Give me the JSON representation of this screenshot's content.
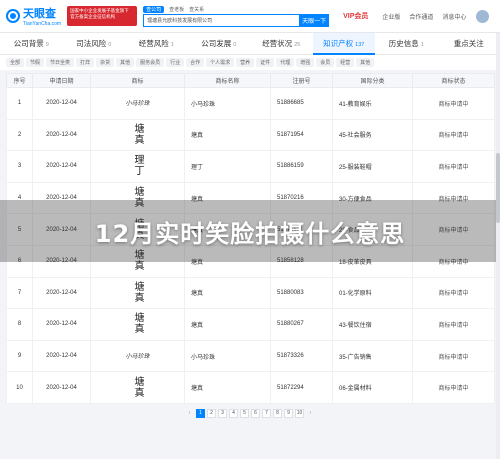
{
  "header": {
    "logo_text": "天眼查",
    "logo_sub": "TianYanCha.com",
    "banner_line1": "国家中小企业发展子基金旗下",
    "banner_line2": "官方备案企业征信机构",
    "search_tabs": [
      "查公司",
      "查老板",
      "查关系"
    ],
    "search_value": "理塘县允欧科技发展有限公司",
    "search_button": "天眼一下",
    "vip_label": "VIP会员",
    "nav": [
      "企业版",
      "合作通道",
      "消息中心"
    ]
  },
  "section_tabs": [
    {
      "label": "公司背景",
      "count": "9"
    },
    {
      "label": "司法风险",
      "count": "0"
    },
    {
      "label": "经营风险",
      "count": "1"
    },
    {
      "label": "公司发展",
      "count": "0"
    },
    {
      "label": "经营状况",
      "count": "25"
    },
    {
      "label": "知识产权",
      "count": "137"
    },
    {
      "label": "历史信息",
      "count": "1"
    },
    {
      "label": "重点关注",
      "count": ""
    }
  ],
  "active_tab_index": 5,
  "filters": [
    "全部",
    "节假",
    "节日全类",
    "打烊",
    "杂货",
    "其他",
    "服务会员",
    "行业",
    "合作",
    "个人需求",
    "营养",
    "证件",
    "代理",
    "增强",
    "会员",
    "经营",
    "其他"
  ],
  "table": {
    "columns": [
      "序号",
      "申请日期",
      "商标",
      "商标名称",
      "注册号",
      "国际分类",
      "商标状态"
    ],
    "rows": [
      {
        "no": "1",
        "date": "2020-12-04",
        "mark": "小马珍珠",
        "mark_style": "script",
        "name": "小马珍珠",
        "reg": "51886685",
        "class": "41-教育娱乐",
        "status": "商标申请中"
      },
      {
        "no": "2",
        "date": "2020-12-04",
        "mark": "塘真",
        "mark_style": "vertical",
        "name": "塘真",
        "reg": "51871954",
        "class": "45-社会服务",
        "status": "商标申请中"
      },
      {
        "no": "3",
        "date": "2020-12-04",
        "mark": "理丁",
        "mark_style": "vertical",
        "name": "理丁",
        "reg": "51886159",
        "class": "25-服装鞋帽",
        "status": "商标申请中"
      },
      {
        "no": "4",
        "date": "2020-12-04",
        "mark": "塘真",
        "mark_style": "vertical",
        "name": "塘真",
        "reg": "51870216",
        "class": "30-方便食品",
        "status": "商标申请中"
      },
      {
        "no": "5",
        "date": "2020-12-04",
        "mark": "塘真",
        "mark_style": "vertical",
        "name": "塘真",
        "reg": "51875511",
        "class": "29-食品",
        "status": "商标申请中"
      },
      {
        "no": "6",
        "date": "2020-12-04",
        "mark": "塘真",
        "mark_style": "vertical",
        "name": "塘真",
        "reg": "51858128",
        "class": "18-皮革皮具",
        "status": "商标申请中"
      },
      {
        "no": "7",
        "date": "2020-12-04",
        "mark": "塘真",
        "mark_style": "vertical",
        "name": "塘真",
        "reg": "51880083",
        "class": "01-化学原料",
        "status": "商标申请中"
      },
      {
        "no": "8",
        "date": "2020-12-04",
        "mark": "塘真",
        "mark_style": "vertical",
        "name": "塘真",
        "reg": "51880267",
        "class": "43-餐饮住宿",
        "status": "商标申请中"
      },
      {
        "no": "9",
        "date": "2020-12-04",
        "mark": "小马珍珠",
        "mark_style": "script",
        "name": "小马珍珠",
        "reg": "51873326",
        "class": "35-广告销售",
        "status": "商标申请中"
      },
      {
        "no": "10",
        "date": "2020-12-04",
        "mark": "塘真",
        "mark_style": "vertical",
        "name": "塘真",
        "reg": "51872294",
        "class": "06-金属材料",
        "status": "商标申请中"
      }
    ]
  },
  "pagination": {
    "prev": "‹",
    "pages": [
      "1",
      "2",
      "3",
      "4",
      "5",
      "6",
      "7",
      "8",
      "9",
      "10"
    ],
    "active": "1",
    "next": "›"
  },
  "overlay_title": "12月实时笑脸拍摄什么意思"
}
